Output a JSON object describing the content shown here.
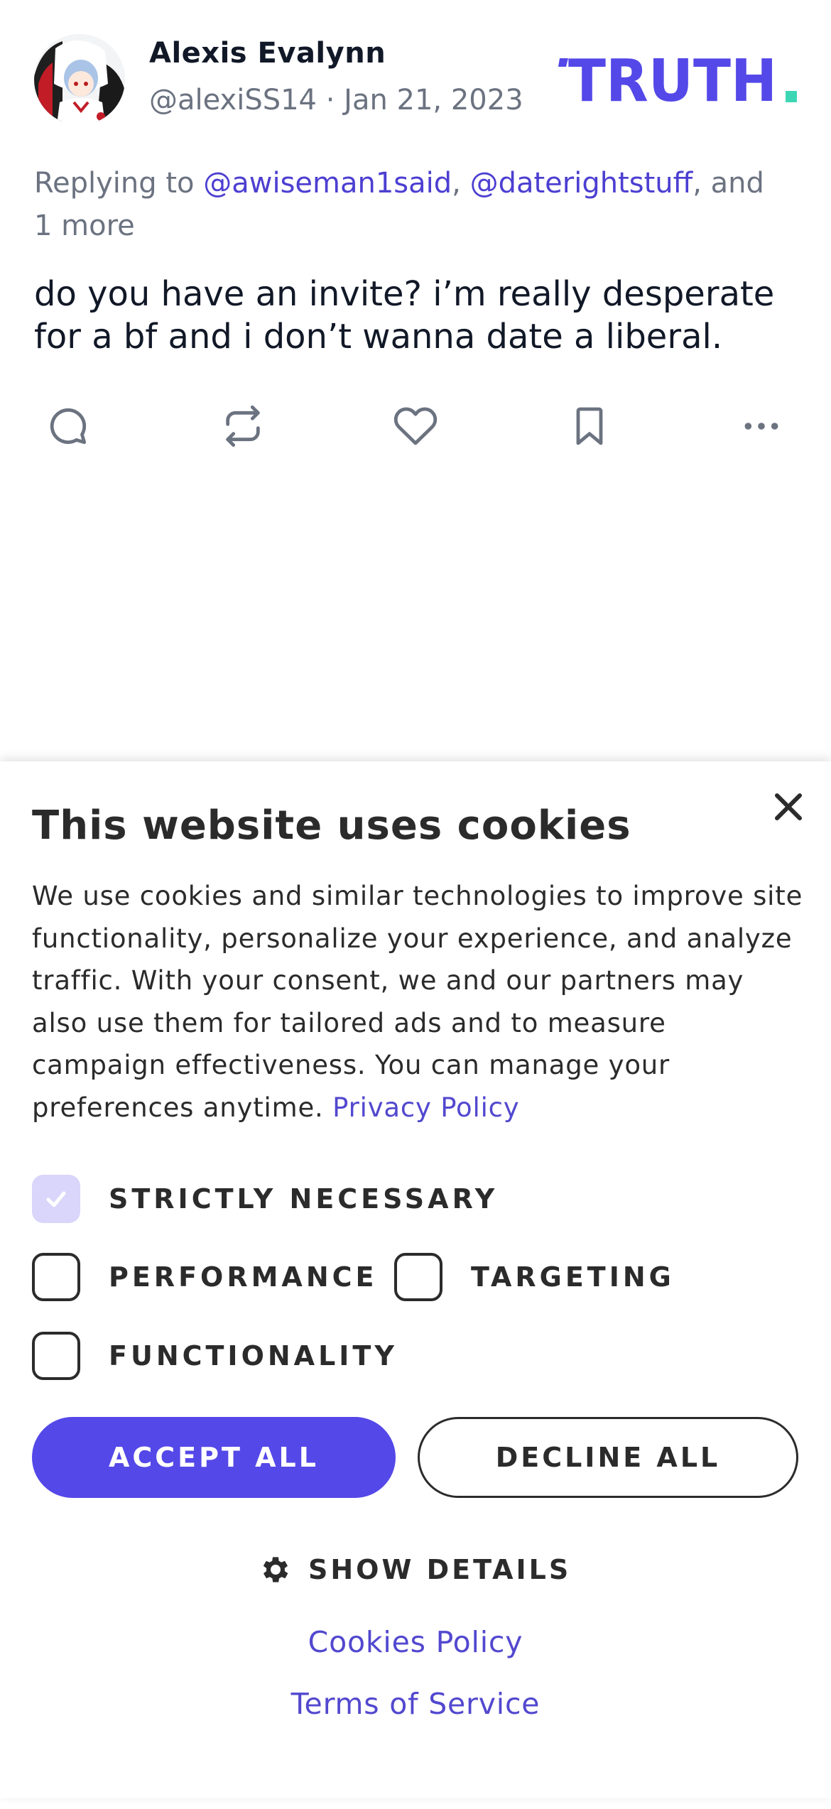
{
  "post": {
    "author_name": "Alexis Evalynn",
    "handle_date": "@alexiSS14 · Jan 21, 2023",
    "logo_text": "TRUTH",
    "replying_prefix": "Replying to ",
    "mention_1": "@awiseman1said",
    "separator": ", ",
    "mention_2": "@daterightstuff",
    "replying_suffix": ", and 1 more",
    "text": "do you have an invite? i’m really desperate for a bf and i don’t wanna date a liberal.",
    "actions": [
      "reply-icon",
      "repost-icon",
      "like-icon",
      "bookmark-icon",
      "more-icon"
    ]
  },
  "cookie": {
    "title": "This website uses cookies",
    "body": "We use cookies and similar technologies to improve site functionality, personalize your experience, and analyze traffic. With your consent, we and our partners may also use them for tailored ads and to measure campaign effectiveness. You can manage your preferences anytime. ",
    "privacy_link": "Privacy Policy",
    "options": {
      "strictly_necessary": "STRICTLY NECESSARY",
      "performance": "PERFORMANCE",
      "targeting": "TARGETING",
      "functionality": "FUNCTIONALITY"
    },
    "accept_label": "ACCEPT ALL",
    "decline_label": "DECLINE ALL",
    "show_details_label": "SHOW DETAILS",
    "cookies_policy_link": "Cookies Policy",
    "terms_link": "Terms of Service"
  },
  "colors": {
    "brand": "#5448e8",
    "link": "#5248cf",
    "logo_dot": "#3dd6b5",
    "muted": "#6b7280"
  }
}
